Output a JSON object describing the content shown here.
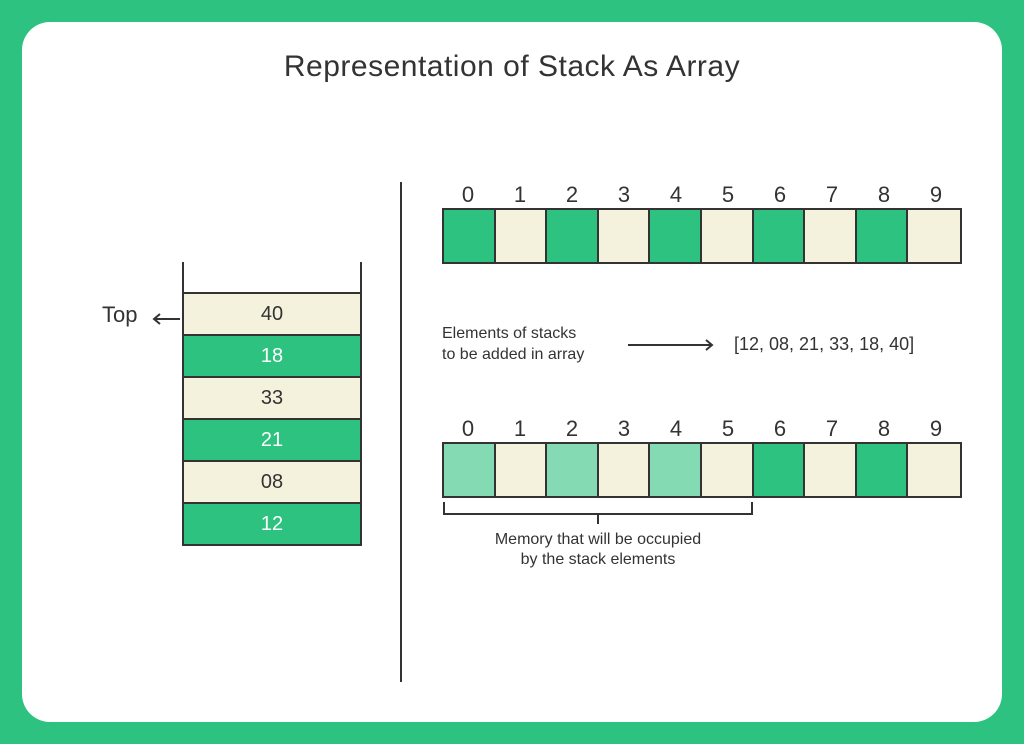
{
  "title": "Representation of Stack As Array",
  "top_label": "Top",
  "stack_cells": [
    {
      "value": "40",
      "variant": "cream"
    },
    {
      "value": "18",
      "variant": "green"
    },
    {
      "value": "33",
      "variant": "cream"
    },
    {
      "value": "21",
      "variant": "green"
    },
    {
      "value": "08",
      "variant": "cream"
    },
    {
      "value": "12",
      "variant": "green"
    }
  ],
  "indices": [
    "0",
    "1",
    "2",
    "3",
    "4",
    "5",
    "6",
    "7",
    "8",
    "9"
  ],
  "array_top_colors": [
    "c-green",
    "c-cream",
    "c-green",
    "c-cream",
    "c-green",
    "c-cream",
    "c-green",
    "c-cream",
    "c-green",
    "c-cream"
  ],
  "array_bottom_colors": [
    "c-lgreen",
    "c-cream",
    "c-lgreen",
    "c-cream",
    "c-lgreen",
    "c-cream",
    "c-green",
    "c-cream",
    "c-green",
    "c-cream"
  ],
  "mid_text_line1": "Elements of stacks",
  "mid_text_line2": "to be added in array",
  "elements_list": "[12, 08, 21, 33, 18, 40]",
  "bracket_caption_line1": "Memory that will be occupied",
  "bracket_caption_line2": "by the stack elements"
}
